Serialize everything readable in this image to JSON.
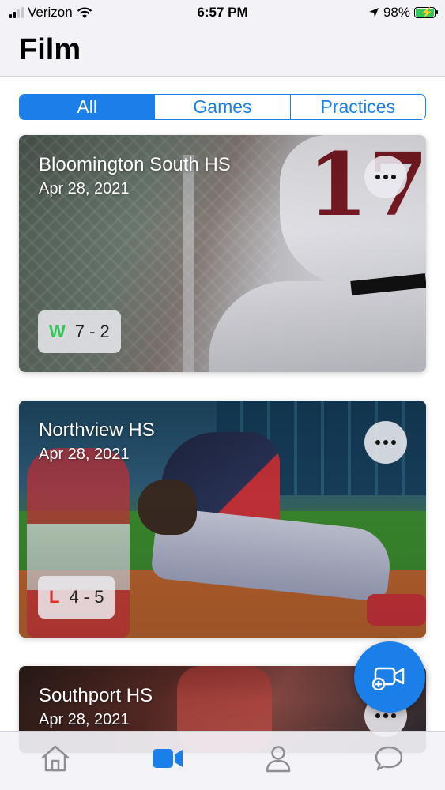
{
  "status_bar": {
    "carrier": "Verizon",
    "time": "6:57 PM",
    "battery_percent": "98%",
    "battery_level": 0.98,
    "icons": [
      "signal-icon",
      "wifi-icon",
      "location-arrow-icon",
      "battery-charging-icon"
    ]
  },
  "header": {
    "title": "Film"
  },
  "filter": {
    "segments": [
      "All",
      "Games",
      "Practices"
    ],
    "selected": "All"
  },
  "films": [
    {
      "title": "Bloomington South HS",
      "date": "Apr 28, 2021",
      "result": "W",
      "score": "7 - 2",
      "result_color": "#34c759"
    },
    {
      "title": "Northview HS",
      "date": "Apr 28, 2021",
      "result": "L",
      "score": "4 - 5",
      "result_color": "#e0302a"
    },
    {
      "title": "Southport HS",
      "date": "Apr 28, 2021"
    }
  ],
  "tab_bar": {
    "items": [
      "home-icon",
      "video-camera-icon",
      "person-icon",
      "chat-bubble-icon"
    ],
    "active": "video-camera-icon",
    "active_color": "#1a7fe8",
    "inactive_color": "#8e8e93"
  },
  "fab": {
    "icon": "add-video-icon",
    "color": "#1a7fe8"
  }
}
